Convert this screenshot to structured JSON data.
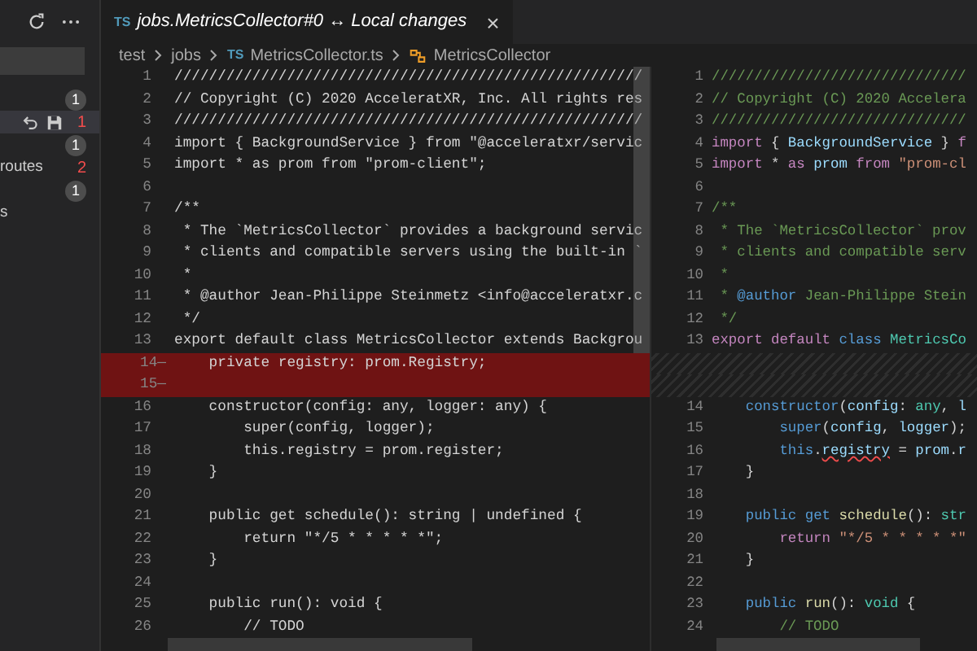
{
  "sidebar": {
    "items": [
      {
        "count": "1",
        "kind": "badge",
        "selected": false
      },
      {
        "count": "1",
        "kind": "text",
        "selected": true
      },
      {
        "count": "1",
        "kind": "badge",
        "selected": false
      },
      {
        "label": "routes",
        "count": "2",
        "kind": "text",
        "selected": false
      },
      {
        "count": "1",
        "kind": "badge",
        "selected": false
      },
      {
        "label": "s",
        "kind": "none",
        "selected": false
      }
    ]
  },
  "tab": {
    "file_badge": "TS",
    "title": "jobs.MetricsCollector#0 ↔ Local changes",
    "close": "×"
  },
  "breadcrumb": {
    "folders": [
      "test",
      "jobs"
    ],
    "file_badge": "TS",
    "file": "MetricsCollector.ts",
    "symbol": "MetricsCollector"
  },
  "left_pane": {
    "lines": [
      {
        "number": "1",
        "text": "//////////////////////////////////////////////////////",
        "kind": "normal"
      },
      {
        "number": "2",
        "text": "// Copyright (C) 2020 AcceleratXR, Inc. All rights res",
        "kind": "normal"
      },
      {
        "number": "3",
        "text": "//////////////////////////////////////////////////////",
        "kind": "normal"
      },
      {
        "number": "4",
        "text": "import { BackgroundService } from \"@acceleratxr/servic",
        "kind": "normal"
      },
      {
        "number": "5",
        "text": "import * as prom from \"prom-client\";",
        "kind": "normal"
      },
      {
        "number": "6",
        "kind": "normal"
      },
      {
        "number": "7",
        "text": "/**",
        "kind": "normal"
      },
      {
        "number": "8",
        "text": " * The `MetricsCollector` provides a background servic",
        "kind": "normal"
      },
      {
        "number": "9",
        "text": " * clients and compatible servers using the built-in `",
        "kind": "normal"
      },
      {
        "number": "10",
        "text": " *",
        "kind": "normal"
      },
      {
        "number": "11",
        "text": " * @author Jean-Philippe Steinmetz <info@acceleratxr.c",
        "kind": "normal"
      },
      {
        "number": "12",
        "text": " */",
        "kind": "normal"
      },
      {
        "number": "13",
        "text": "export default class MetricsCollector extends Backgrou",
        "kind": "normal"
      },
      {
        "number": "14",
        "marker": "—",
        "text": "    private registry: prom.Registry;",
        "kind": "deleted"
      },
      {
        "number": "15",
        "marker": "—",
        "kind": "deleted"
      },
      {
        "number": "16",
        "text": "    constructor(config: any, logger: any) {",
        "kind": "normal"
      },
      {
        "number": "17",
        "text": "        super(config, logger);",
        "kind": "normal"
      },
      {
        "number": "18",
        "text": "        this.registry = prom.register;",
        "kind": "normal"
      },
      {
        "number": "19",
        "text": "    }",
        "kind": "normal"
      },
      {
        "number": "20",
        "kind": "normal"
      },
      {
        "number": "21",
        "text": "    public get schedule(): string | undefined {",
        "kind": "normal"
      },
      {
        "number": "22",
        "text": "        return \"*/5 * * * * *\";",
        "kind": "normal"
      },
      {
        "number": "23",
        "text": "    }",
        "kind": "normal"
      },
      {
        "number": "24",
        "kind": "normal"
      },
      {
        "number": "25",
        "text": "    public run(): void {",
        "kind": "normal"
      },
      {
        "number": "26",
        "text": "        // TODO",
        "kind": "normal"
      }
    ]
  },
  "right_pane": {
    "lines": [
      {
        "kind": "code",
        "number": "1",
        "tokens": [
          {
            "text": "//////////////////////////////",
            "kind": "comment"
          }
        ]
      },
      {
        "kind": "code",
        "number": "2",
        "tokens": [
          {
            "text": "// Copyright (C) 2020 Accelera",
            "kind": "comment"
          }
        ]
      },
      {
        "kind": "code",
        "number": "3",
        "tokens": [
          {
            "text": "//////////////////////////////",
            "kind": "comment"
          }
        ]
      },
      {
        "kind": "code",
        "number": "4",
        "tokens": [
          {
            "text": "import",
            "kind": "keyword"
          },
          {
            "text": " { ",
            "kind": "plain"
          },
          {
            "text": "BackgroundService",
            "kind": "variable"
          },
          {
            "text": " } ",
            "kind": "plain"
          },
          {
            "text": "f",
            "kind": "keyword"
          }
        ]
      },
      {
        "kind": "code",
        "number": "5",
        "tokens": [
          {
            "text": "import",
            "kind": "keyword"
          },
          {
            "text": " * ",
            "kind": "plain"
          },
          {
            "text": "as ",
            "kind": "keyword"
          },
          {
            "text": "prom ",
            "kind": "variable"
          },
          {
            "text": "from ",
            "kind": "keyword"
          },
          {
            "text": "\"prom-cl",
            "kind": "string"
          }
        ]
      },
      {
        "kind": "code",
        "number": "6"
      },
      {
        "kind": "code",
        "number": "7",
        "tokens": [
          {
            "text": "/**",
            "kind": "comment"
          }
        ]
      },
      {
        "kind": "code",
        "number": "8",
        "tokens": [
          {
            "text": " * The `MetricsCollector` prov",
            "kind": "comment"
          }
        ]
      },
      {
        "kind": "code",
        "number": "9",
        "tokens": [
          {
            "text": " * clients and compatible serv",
            "kind": "comment"
          }
        ]
      },
      {
        "kind": "code",
        "number": "10",
        "tokens": [
          {
            "text": " *",
            "kind": "comment"
          }
        ]
      },
      {
        "kind": "code",
        "number": "11",
        "tokens": [
          {
            "text": " * ",
            "kind": "comment"
          },
          {
            "text": "@author",
            "kind": "storage"
          },
          {
            "text": " Jean-Philippe Stein",
            "kind": "comment"
          }
        ]
      },
      {
        "kind": "code",
        "number": "12",
        "tokens": [
          {
            "text": " */",
            "kind": "comment"
          }
        ]
      },
      {
        "kind": "code",
        "number": "13",
        "tokens": [
          {
            "text": "export ",
            "kind": "keyword"
          },
          {
            "text": "default ",
            "kind": "keyword"
          },
          {
            "text": "class ",
            "kind": "storage"
          },
          {
            "text": "MetricsCo",
            "kind": "type"
          }
        ]
      },
      {
        "kind": "filler"
      },
      {
        "kind": "filler"
      },
      {
        "kind": "code",
        "number": "14",
        "tokens": [
          {
            "text": "    constructor",
            "kind": "storage"
          },
          {
            "text": "(",
            "kind": "plain"
          },
          {
            "text": "config",
            "kind": "variable"
          },
          {
            "text": ": ",
            "kind": "plain"
          },
          {
            "text": "any",
            "kind": "type"
          },
          {
            "text": ", ",
            "kind": "plain"
          },
          {
            "text": "l",
            "kind": "variable"
          }
        ]
      },
      {
        "kind": "code",
        "number": "15",
        "tokens": [
          {
            "text": "        super",
            "kind": "storage"
          },
          {
            "text": "(",
            "kind": "plain"
          },
          {
            "text": "config",
            "kind": "variable"
          },
          {
            "text": ", ",
            "kind": "plain"
          },
          {
            "text": "logger",
            "kind": "variable"
          },
          {
            "text": ");",
            "kind": "plain"
          }
        ]
      },
      {
        "kind": "code",
        "number": "16",
        "tokens": [
          {
            "text": "        this",
            "kind": "storage"
          },
          {
            "text": ".",
            "kind": "plain"
          },
          {
            "text": "registry",
            "kind": "error"
          },
          {
            "text": " = ",
            "kind": "plain"
          },
          {
            "text": "prom",
            "kind": "variable"
          },
          {
            "text": ".",
            "kind": "plain"
          },
          {
            "text": "r",
            "kind": "variable"
          }
        ]
      },
      {
        "kind": "code",
        "number": "17",
        "tokens": [
          {
            "text": "    }",
            "kind": "plain"
          }
        ]
      },
      {
        "kind": "code",
        "number": "18"
      },
      {
        "kind": "code",
        "number": "19",
        "tokens": [
          {
            "text": "    public ",
            "kind": "storage"
          },
          {
            "text": "get ",
            "kind": "storage"
          },
          {
            "text": "schedule",
            "kind": "function"
          },
          {
            "text": "(): ",
            "kind": "plain"
          },
          {
            "text": "str",
            "kind": "type"
          }
        ]
      },
      {
        "kind": "code",
        "number": "20",
        "tokens": [
          {
            "text": "        return ",
            "kind": "keyword"
          },
          {
            "text": "\"*/5 * * * * *\"",
            "kind": "string"
          }
        ]
      },
      {
        "kind": "code",
        "number": "21",
        "tokens": [
          {
            "text": "    }",
            "kind": "plain"
          }
        ]
      },
      {
        "kind": "code",
        "number": "22"
      },
      {
        "kind": "code",
        "number": "23",
        "tokens": [
          {
            "text": "    public ",
            "kind": "storage"
          },
          {
            "text": "run",
            "kind": "function"
          },
          {
            "text": "(): ",
            "kind": "plain"
          },
          {
            "text": "void",
            "kind": "type"
          },
          {
            "text": " {",
            "kind": "plain"
          }
        ]
      },
      {
        "kind": "code",
        "number": "24",
        "tokens": [
          {
            "text": "        // TODO",
            "kind": "comment"
          }
        ]
      }
    ]
  }
}
